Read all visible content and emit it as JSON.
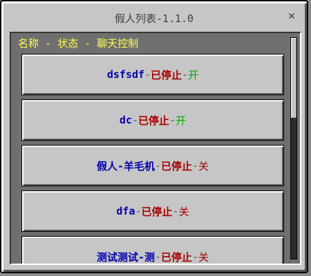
{
  "window": {
    "title": "假人列表-1.1.0",
    "close_label": "✕"
  },
  "header": {
    "text": "名称 - 状态 - 聊天控制"
  },
  "separator": " - ",
  "rows": [
    {
      "name": "dsfsdf",
      "state": "已停止",
      "chat": "开",
      "chat_color": "#00aa00"
    },
    {
      "name": "dc",
      "state": "已停止",
      "chat": "开",
      "chat_color": "#00aa00"
    },
    {
      "name": "假人-羊毛机",
      "state": "已停止",
      "chat": "关",
      "chat_color": "#aa0000"
    },
    {
      "name": "dfa",
      "state": "已停止",
      "chat": "关",
      "chat_color": "#aa0000"
    },
    {
      "name": "测试测试-测",
      "state": "已停止",
      "chat": "关",
      "chat_color": "#aa0000"
    }
  ],
  "colors": {
    "name": "#0000aa",
    "state": "#aa0000",
    "header": "#ffff55",
    "chat_on": "#00aa00",
    "chat_off": "#aa0000"
  }
}
